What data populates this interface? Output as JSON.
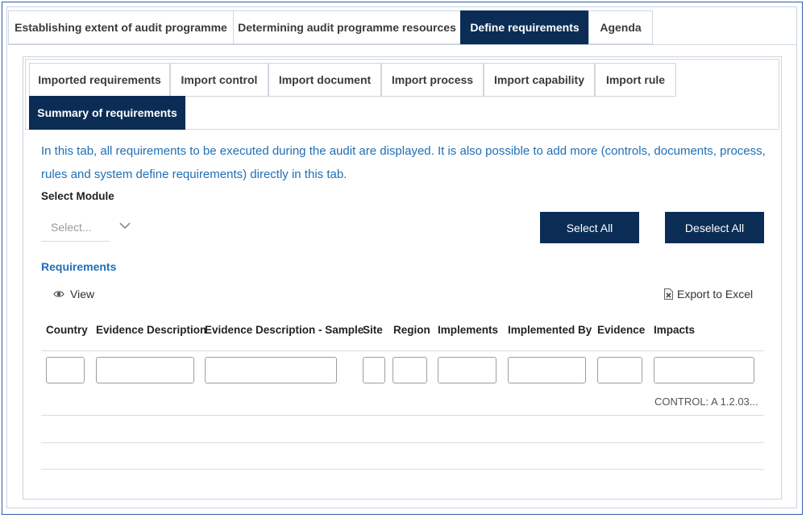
{
  "top_tabs": [
    {
      "label": "Establishing extent of audit programme",
      "active": false
    },
    {
      "label": "Determining audit programme resources",
      "active": false
    },
    {
      "label": "Define requirements",
      "active": true
    },
    {
      "label": "Agenda",
      "active": false
    }
  ],
  "sub_tabs": [
    {
      "label": "Imported requirements",
      "active": false
    },
    {
      "label": "Import control",
      "active": false
    },
    {
      "label": "Import document",
      "active": false
    },
    {
      "label": "Import process",
      "active": false
    },
    {
      "label": "Import capability",
      "active": false
    },
    {
      "label": "Import rule",
      "active": false
    },
    {
      "label": "Summary of requirements",
      "active": true
    }
  ],
  "info_text": "In this tab, all requirements to be executed during the audit are displayed. It is also possible to add more (controls, documents, process, rules and system define requirements) directly in this tab.",
  "module": {
    "label": "Select Module",
    "placeholder": "Select..."
  },
  "buttons": {
    "select_all": "Select All",
    "deselect_all": "Deselect All"
  },
  "requirements": {
    "title": "Requirements",
    "view_label": "View",
    "export_label": "Export to Excel",
    "columns": [
      "Country",
      "Evidence Description",
      "Evidence Description - Sample",
      "Site",
      "Region",
      "Implements",
      "Implemented By",
      "Evidence",
      "Impacts"
    ],
    "rows": [
      {
        "impacts": "CONTROL: A 1.2.03..."
      }
    ]
  },
  "colors": {
    "active_tab": "#0b2d55",
    "link_blue": "#1f6fb5"
  }
}
